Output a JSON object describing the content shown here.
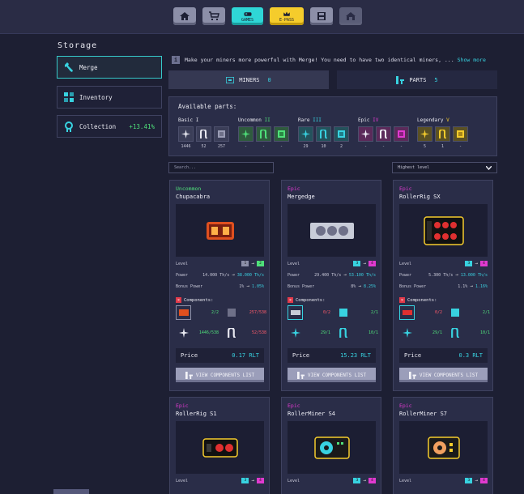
{
  "nav": {
    "games_label": "GAMES",
    "epass_label": "E-PASS"
  },
  "storage": {
    "title": "Storage",
    "merge_label": "Merge",
    "inventory_label": "Inventory",
    "collection_label": "Collection",
    "collection_bonus": "+13.41%"
  },
  "info": {
    "text": "Make your miners more powerful with Merge! You need to have two identical miners, ...",
    "link": "Show more"
  },
  "tabs": {
    "miners_label": "MINERS",
    "miners_count": "0",
    "parts_label": "PARTS",
    "parts_count": "5"
  },
  "parts": {
    "title": "Available parts:",
    "groups": [
      {
        "name": "Basic",
        "level": "I",
        "color": "#e8e8f0",
        "counts": [
          "1446",
          "52",
          "257"
        ]
      },
      {
        "name": "Uncommon",
        "level": "II",
        "color": "#4fe07a",
        "counts": [
          "-",
          "-",
          "-"
        ]
      },
      {
        "name": "Rare",
        "level": "III",
        "color": "#38d2e0",
        "counts": [
          "29",
          "10",
          "2"
        ]
      },
      {
        "name": "Epic",
        "level": "IV",
        "color": "#e03ad0",
        "counts": [
          "-",
          "-",
          "-"
        ]
      },
      {
        "name": "Legendary",
        "level": "V",
        "color": "#f5cc2c",
        "counts": [
          "5",
          "1",
          "-"
        ]
      }
    ]
  },
  "filters": {
    "search_placeholder": "Search...",
    "sort_value": "Highest level"
  },
  "labels": {
    "level": "Level",
    "power": "Power",
    "bonus": "Bonus Power",
    "components": "Components:",
    "price": "Price",
    "view": "VIEW COMPONENTS LIST"
  },
  "cards": [
    {
      "rarity": "Uncommon",
      "rarity_color": "#4fe07a",
      "name": "Chupacabra",
      "power_from": "14.000 Th/s",
      "power_to": "38.000 Th/s",
      "bonus_from": "1%",
      "bonus_to": "1.05%",
      "components": [
        {
          "value": "2/2",
          "ok": true
        },
        {
          "value": "257/538",
          "ok": false
        },
        {
          "value": "1446/538",
          "ok": true
        },
        {
          "value": "52/538",
          "ok": false
        }
      ],
      "price": "0.17 RLT"
    },
    {
      "rarity": "Epic",
      "rarity_color": "#e03ad0",
      "name": "Mergedge",
      "power_from": "29.400 Th/s",
      "power_to": "53.100 Th/s",
      "bonus_from": "8%",
      "bonus_to": "8.25%",
      "components": [
        {
          "value": "0/2",
          "ok": false
        },
        {
          "value": "2/1",
          "ok": true
        },
        {
          "value": "29/1",
          "ok": true
        },
        {
          "value": "10/1",
          "ok": true
        }
      ],
      "price": "15.23 RLT"
    },
    {
      "rarity": "Epic",
      "rarity_color": "#e03ad0",
      "name": "RollerRig SX",
      "power_from": "5.300 Th/s",
      "power_to": "13.000 Th/s",
      "bonus_from": "1.1%",
      "bonus_to": "1.16%",
      "components": [
        {
          "value": "0/2",
          "ok": false
        },
        {
          "value": "2/1",
          "ok": true
        },
        {
          "value": "29/1",
          "ok": true
        },
        {
          "value": "10/1",
          "ok": true
        }
      ],
      "price": "0.3 RLT"
    },
    {
      "rarity": "Epic",
      "rarity_color": "#e03ad0",
      "name": "RollerRig S1"
    },
    {
      "rarity": "Epic",
      "rarity_color": "#e03ad0",
      "name": "RollerMiner S4"
    },
    {
      "rarity": "Epic",
      "rarity_color": "#e03ad0",
      "name": "RollerMiner S7"
    }
  ],
  "colors": {
    "accent": "#38d2e0",
    "uncommon": "#4fe07a",
    "epic": "#e03ad0",
    "legendary": "#f5cc2c",
    "rare": "#38d2e0"
  }
}
